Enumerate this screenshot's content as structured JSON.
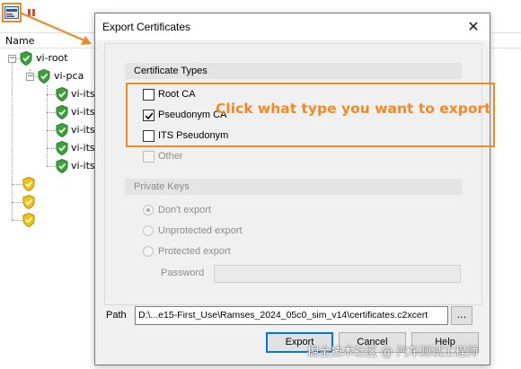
{
  "background_app": {
    "tree_header": "Name",
    "tree": [
      {
        "label": "vi-root"
      },
      {
        "label": "vi-pca"
      },
      {
        "label": "vi-its-"
      },
      {
        "label": "vi-its-"
      },
      {
        "label": "vi-its-"
      },
      {
        "label": "vi-its-"
      },
      {
        "label": "vi-its-"
      }
    ]
  },
  "dialog": {
    "title": "Export Certificates",
    "close_icon": "close-icon",
    "certificate_types": {
      "header": "Certificate Types",
      "options": [
        {
          "label": "Root CA",
          "checked": false,
          "enabled": true
        },
        {
          "label": "Pseudonym CA",
          "checked": true,
          "enabled": true
        },
        {
          "label": "ITS Pseudonym",
          "checked": false,
          "enabled": true
        },
        {
          "label": "Other",
          "checked": false,
          "enabled": false
        }
      ]
    },
    "private_keys": {
      "header": "Private Keys",
      "options": [
        {
          "label": "Don't export",
          "selected": true
        },
        {
          "label": "Unprotected export",
          "selected": false
        },
        {
          "label": "Protected export",
          "selected": false
        }
      ],
      "password_label": "Password",
      "password_value": ""
    },
    "path": {
      "label": "Path",
      "value": "D:\\...e15-First_Use\\Ramses_2024_05c0_sim_v14\\certificates.c2xcert",
      "browse_label": "..."
    },
    "buttons": {
      "export": "Export",
      "cancel": "Cancel",
      "help": "Help"
    }
  },
  "annotation": {
    "text": "Click what type you want to export",
    "color": "#f08a24"
  },
  "watermark": "掘金技术社区 @ 汽车测试工程师"
}
